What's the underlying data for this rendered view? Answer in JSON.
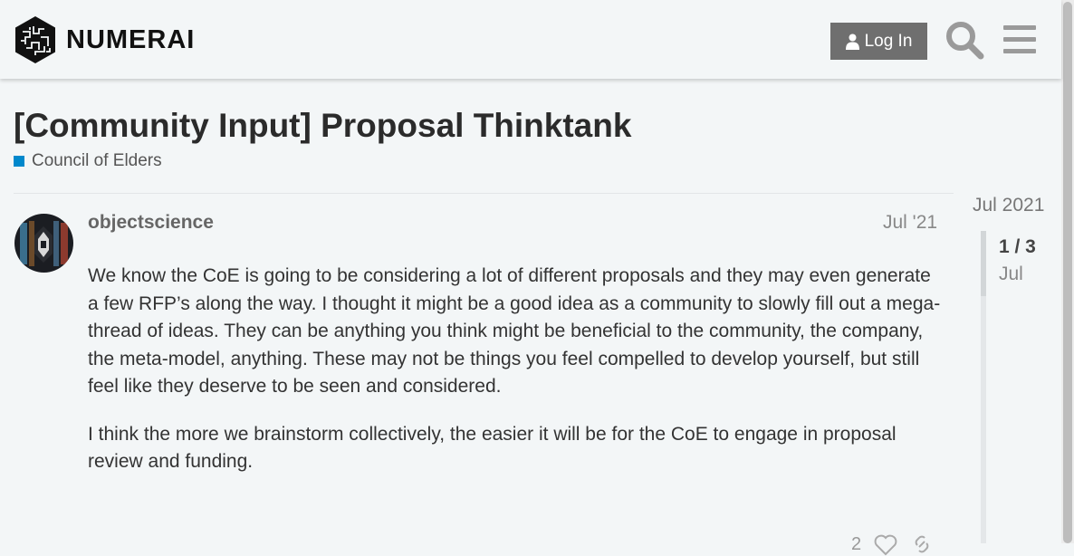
{
  "header": {
    "logo_text": "NUMERAI",
    "login_label": "Log In"
  },
  "topic": {
    "title": "[Community Input] Proposal Thinktank",
    "category": "Council of Elders",
    "category_color": "#0088cc"
  },
  "post": {
    "username": "objectscience",
    "date": "Jul '21",
    "paragraphs": [
      "We know the CoE is going to be considering a lot of different proposals and they may even generate a few RFP’s along the way. I thought it might be a good idea as a community to slowly fill out a mega-thread of ideas. They can be anything you think might be beneficial to the community, the company, the meta-model, anything. These may not be things you feel compelled to develop yourself, but still feel like they deserve to be seen and considered.",
      "I think the more we brainstorm collectively, the easier it will be for the CoE to engage in proposal review and funding."
    ],
    "like_count": "2"
  },
  "timeline": {
    "top_date": "Jul 2021",
    "position": "1 / 3",
    "current_month": "Jul"
  },
  "icons": {
    "search": "search-icon",
    "menu": "hamburger-menu-icon",
    "user": "user-icon",
    "like": "heart-icon",
    "link": "link-icon"
  }
}
